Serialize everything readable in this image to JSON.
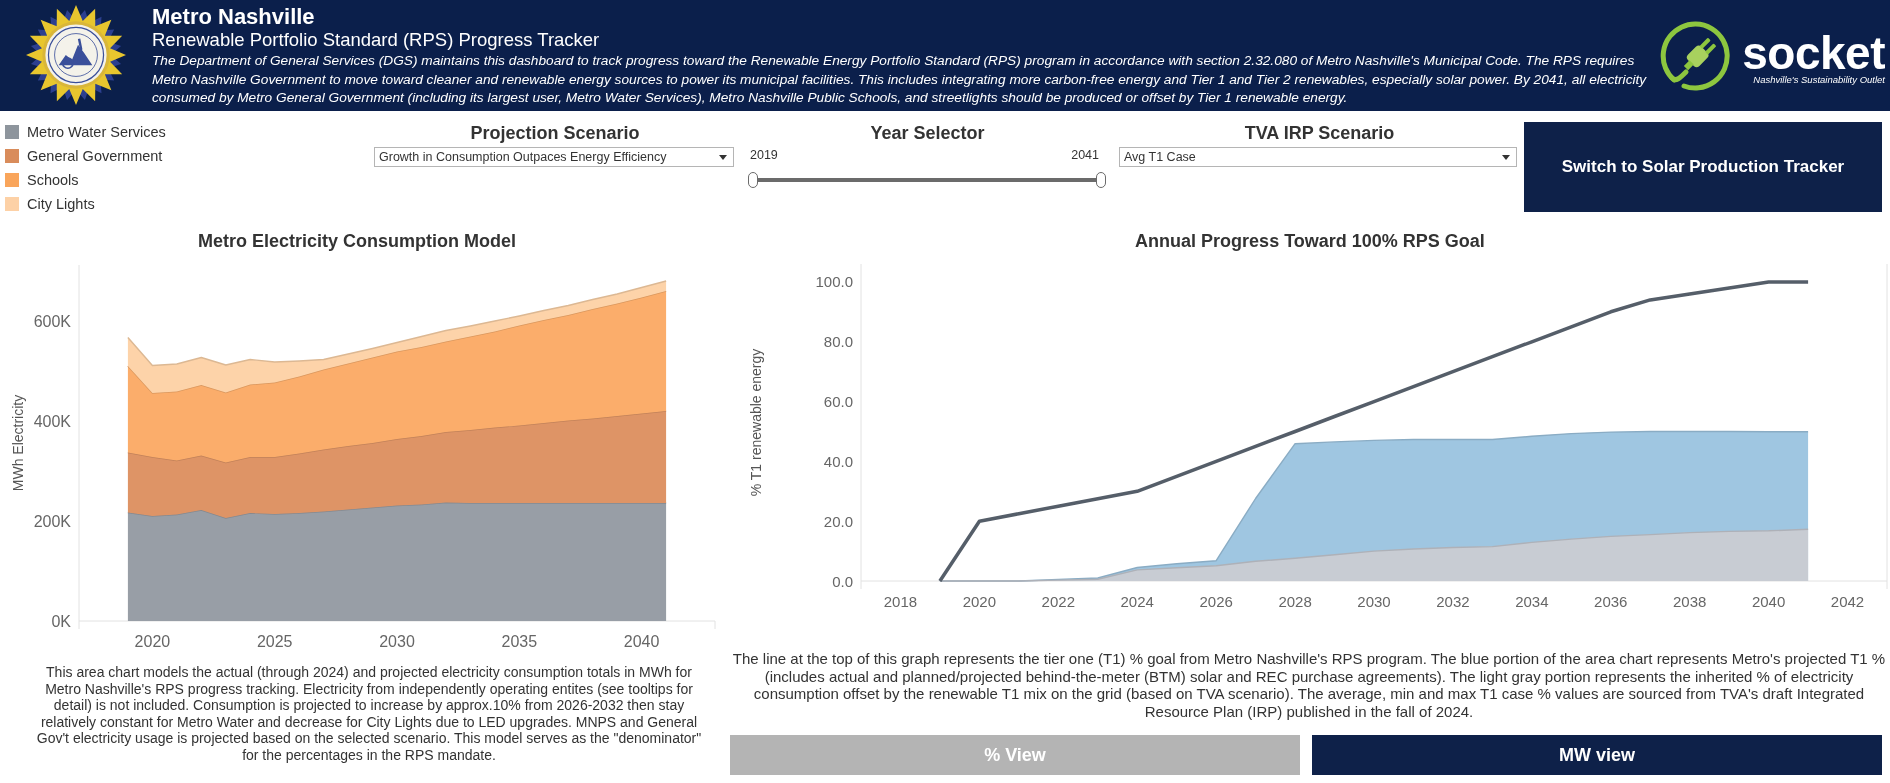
{
  "header": {
    "title": "Metro Nashville",
    "subtitle": "Renewable Portfolio Standard (RPS) Progress Tracker",
    "description": "The Department of General Services (DGS) maintains this dashboard to track progress toward the Renewable Energy Portfolio Standard (RPS) program in accordance with section 2.32.080 of Metro Nashville's Municipal Code. The RPS requires Metro Nashville Government to move toward cleaner and renewable energy sources to power its municipal facilities. This includes integrating more carbon-free energy and Tier 1 and Tier 2 renewables, especially solar power. By 2041, all electricity consumed by Metro General Government (including its largest user, Metro Water Services), Metro Nashville Public Schools, and streetlights should be produced or offset by Tier 1 renewable energy.",
    "brand": {
      "name": "socket",
      "tagline": "Nashville's Sustainability Outlet"
    }
  },
  "controls": {
    "legend": [
      {
        "label": "Metro Water Services",
        "color": "#8e959d"
      },
      {
        "label": "General Government",
        "color": "#d98c5b"
      },
      {
        "label": "Schools",
        "color": "#f9a55b"
      },
      {
        "label": "City Lights",
        "color": "#fdd1a6"
      }
    ],
    "projection_scenario": {
      "title": "Projection Scenario",
      "value": "Growth in Consumption Outpaces Energy Efficiency"
    },
    "year_selector": {
      "title": "Year Selector",
      "start_label": "2019",
      "end_label": "2041",
      "handles": [
        {
          "level": 0
        },
        {
          "level": 1
        }
      ]
    },
    "tva_irp_scenario": {
      "title": "TVA IRP Scenario",
      "value": "Avg T1 Case"
    },
    "solar_tracker_button": {
      "label": "Switch to Solar Production Tracker"
    }
  },
  "consumption_panel": {
    "chart_data": {
      "type": "area",
      "title": "Metro Electricity Consumption Model",
      "ylabel": "MWh Electricity",
      "x": [
        2019,
        2020,
        2021,
        2022,
        2023,
        2024,
        2025,
        2026,
        2027,
        2028,
        2029,
        2030,
        2031,
        2032,
        2033,
        2034,
        2035,
        2036,
        2037,
        2038,
        2039,
        2040,
        2041
      ],
      "xlim": [
        2017,
        2043
      ],
      "ylim": [
        0,
        712000
      ],
      "xticks": [
        2020,
        2025,
        2030,
        2035,
        2040
      ],
      "yticks": [
        {
          "value": 0,
          "label": "0K"
        },
        {
          "value": 200000,
          "label": "200K"
        },
        {
          "value": 400000,
          "label": "400K"
        },
        {
          "value": 600000,
          "label": "600K"
        }
      ],
      "stacked": true,
      "series": [
        {
          "color": "#989ea6",
          "values": [
            217000,
            210000,
            213000,
            222000,
            206000,
            216000,
            214000,
            216000,
            219000,
            223000,
            227000,
            231000,
            233000,
            237000,
            236000,
            236000,
            236000,
            236000,
            236000,
            236000,
            236000,
            236000,
            236000
          ]
        },
        {
          "color": "#de9466",
          "values": [
            120000,
            118000,
            108000,
            109000,
            111000,
            112000,
            114000,
            119000,
            124000,
            127000,
            129000,
            133000,
            137000,
            141000,
            146000,
            151000,
            155000,
            160000,
            165000,
            169000,
            174000,
            179000,
            184000
          ]
        },
        {
          "color": "#fbad6b",
          "values": [
            173000,
            128000,
            138000,
            141000,
            140000,
            145000,
            149000,
            154000,
            160000,
            165000,
            171000,
            175000,
            178000,
            181000,
            187000,
            192000,
            200000,
            206000,
            211000,
            219000,
            225000,
            232000,
            240000
          ]
        },
        {
          "color": "#fdd3a9",
          "values": [
            57000,
            55000,
            55000,
            55000,
            55000,
            50000,
            41000,
            31000,
            20000,
            19000,
            18000,
            18000,
            21000,
            22000,
            21000,
            21000,
            19000,
            19000,
            19000,
            19000,
            19000,
            20000,
            20000
          ]
        }
      ]
    },
    "description": "This area chart models the actual (through 2024) and projected electricity consumption totals in MWh for Metro Nashville's RPS progress tracking. Electricity from independently operating entites (see tooltips for detail) is not included. Consumption is projected to increase by approx.10% from 2026-2032 then stay relatively constant for Metro Water and decrease for City Lights due to LED upgrades. MNPS and General Gov't electricity usage is projected based on the selected scenario. This model serves as the \"denominator\" for the percentages in the RPS mandate."
  },
  "progress_panel": {
    "chart_data": {
      "type": "area",
      "title": "Annual Progress Toward 100% RPS Goal",
      "ylabel": "% T1 renewable energy",
      "x": [
        2019,
        2020,
        2021,
        2022,
        2023,
        2024,
        2025,
        2026,
        2027,
        2028,
        2029,
        2030,
        2031,
        2032,
        2033,
        2034,
        2035,
        2036,
        2037,
        2038,
        2039,
        2040,
        2041
      ],
      "xlim": [
        2017,
        2043
      ],
      "ylim": [
        0,
        106
      ],
      "xticks": [
        2018,
        2020,
        2022,
        2024,
        2026,
        2028,
        2030,
        2032,
        2034,
        2036,
        2038,
        2040,
        2042
      ],
      "yticks": [
        {
          "value": 0,
          "label": "0.0"
        },
        {
          "value": 20,
          "label": "20.0"
        },
        {
          "value": 40,
          "label": "40.0"
        },
        {
          "value": 60,
          "label": "60.0"
        },
        {
          "value": 80,
          "label": "80.0"
        },
        {
          "value": 100,
          "label": "100.0"
        }
      ],
      "stacked": false,
      "series": [
        {
          "color": "#9fc6e1",
          "values": [
            0,
            0,
            0,
            0.5,
            1,
            4.5,
            5.8,
            6.8,
            27.6,
            45.9,
            46.5,
            47,
            47.3,
            47.3,
            47.3,
            48.4,
            49.3,
            49.8,
            50,
            50,
            50,
            49.9,
            49.9
          ]
        },
        {
          "color": "#c8ccd3",
          "values": [
            0,
            0,
            0,
            0.3,
            0.6,
            3.7,
            4.4,
            5.1,
            6.6,
            7.6,
            8.8,
            10,
            10.7,
            11.2,
            11.5,
            12.9,
            14,
            14.9,
            15.5,
            16.2,
            16.6,
            16.8,
            17.3
          ]
        },
        {
          "type": "line",
          "color": "#555e69",
          "values": [
            0,
            20,
            22.5,
            25,
            27.5,
            30,
            35,
            40,
            45,
            50,
            55,
            60,
            65,
            70,
            75,
            80,
            85,
            90,
            94,
            96,
            98,
            100,
            100
          ]
        }
      ]
    },
    "description": "The line at the top of this graph represents the tier one (T1) % goal from Metro Nashville's RPS program. The blue portion of the area chart represents Metro's projected T1 % (includes actual and planned/projected behind-the-meter (BTM) solar and REC purchase agreements). The light gray portion represents the inherited % of electricity consumption offset by the renewable T1 mix on the grid (based on TVA scenario). The average, min and max T1 case % values are sourced from TVA's draft Integrated Resource Plan (IRP) published in the fall of 2024.",
    "view_buttons": [
      {
        "label": "% View",
        "selected": true
      },
      {
        "label": "MW view",
        "selected": false
      }
    ]
  }
}
